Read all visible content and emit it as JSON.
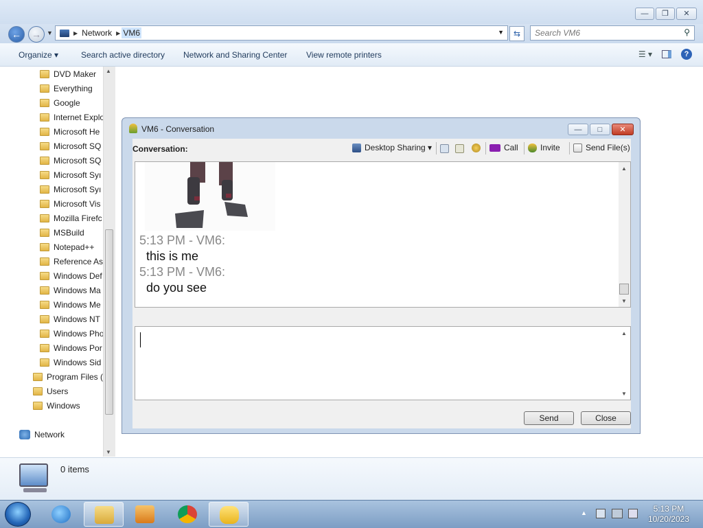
{
  "explorer": {
    "title_buttons": {
      "minimize": "—",
      "maximize": "❐",
      "close": "✕"
    },
    "address": {
      "crumbs": [
        "Network",
        "VM6"
      ],
      "search_placeholder": "Search VM6"
    },
    "commands": [
      "Organize",
      "Search active directory",
      "Network and Sharing Center",
      "View remote printers"
    ],
    "organize_label": "Organize",
    "nav_items": [
      "DVD Maker",
      "Everything",
      "Google",
      "Internet Explo",
      "Microsoft He",
      "Microsoft SQ",
      "Microsoft SQ",
      "Microsoft Syı",
      "Microsoft Syı",
      "Microsoft Vis",
      "Mozilla Firefc",
      "MSBuild",
      "Notepad++",
      "Reference As",
      "Windows Def",
      "Windows Ma",
      "Windows Me",
      "Windows NT",
      "Windows Pho",
      "Windows Por",
      "Windows Sid"
    ],
    "nav_top_items": [
      "Program Files (",
      "Users",
      "Windows"
    ],
    "network_label": "Network",
    "item_count": "0 items"
  },
  "conversation": {
    "title": "VM6 - Conversation",
    "label": "Conversation:",
    "toolbar": {
      "desktop_sharing": "Desktop Sharing",
      "call": "Call",
      "invite": "Invite",
      "send_files": "Send File(s)"
    },
    "messages": [
      {
        "meta": "5:13 PM - VM6:",
        "text": "this is me"
      },
      {
        "meta": "5:13 PM - VM6:",
        "text": "do you see"
      }
    ],
    "send_label": "Send",
    "close_label": "Close"
  },
  "taskbar": {
    "time": "5:13 PM",
    "date": "10/20/2023"
  }
}
